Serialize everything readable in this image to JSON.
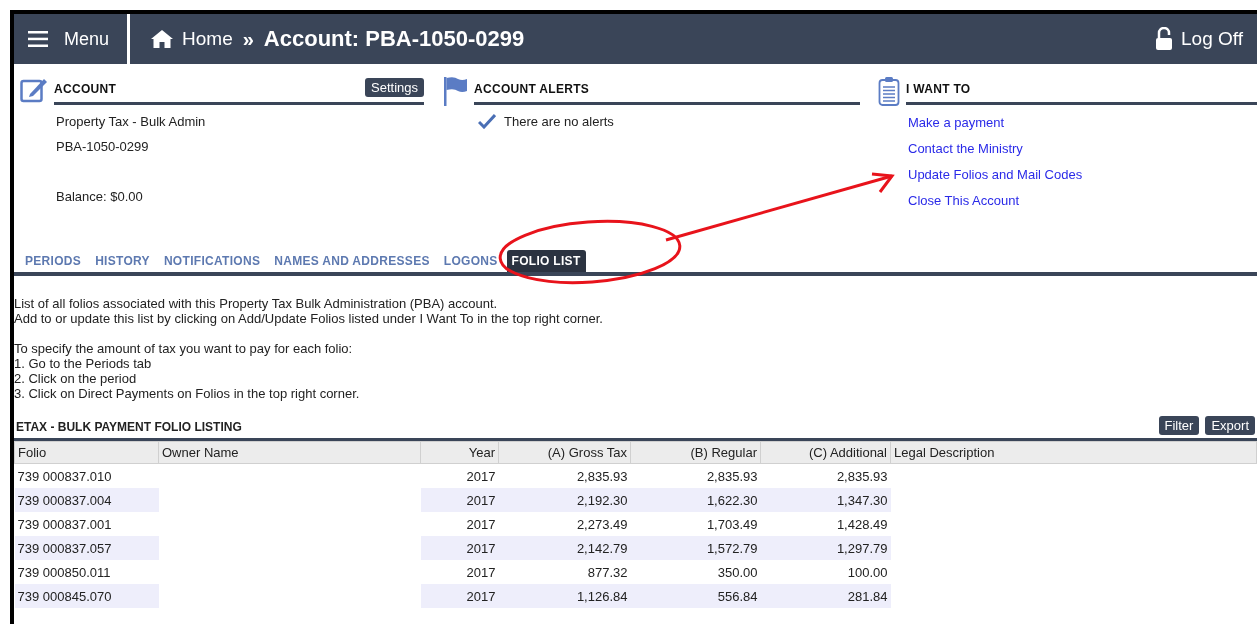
{
  "header": {
    "menu_label": "Menu",
    "home_label": "Home",
    "separator": "»",
    "title": "Account: PBA-1050-0299",
    "logoff_label": "Log Off"
  },
  "account": {
    "heading": "ACCOUNT",
    "settings_label": "Settings",
    "lines": [
      "Property Tax - Bulk Admin",
      "PBA-1050-0299"
    ],
    "balance": "Balance: $0.00"
  },
  "alerts": {
    "heading": "ACCOUNT ALERTS",
    "message": "There are no alerts"
  },
  "i_want_to": {
    "heading": "I WANT TO",
    "links": [
      "Make a payment",
      "Contact the Ministry",
      "Update Folios and Mail Codes",
      "Close This Account"
    ]
  },
  "tabs": [
    {
      "label": "PERIODS",
      "selected": false
    },
    {
      "label": "HISTORY",
      "selected": false
    },
    {
      "label": "NOTIFICATIONS",
      "selected": false
    },
    {
      "label": "NAMES AND ADDRESSES",
      "selected": false
    },
    {
      "label": "LOGONS",
      "selected": false
    },
    {
      "label": "FOLIO LIST",
      "selected": true
    }
  ],
  "intro": [
    "List of all folios associated with this Property Tax Bulk Administration (PBA) account.",
    "Add to or update this list by clicking on Add/Update Folios listed under I Want To in the top right corner."
  ],
  "instructions": [
    "To specify the amount of tax you want to pay for each folio:",
    "1. Go to the Periods tab",
    "2. Click on the period",
    "3. Click on Direct Payments on Folios in the top right corner."
  ],
  "table": {
    "title": "ETAX - BULK PAYMENT FOLIO LISTING",
    "buttons": [
      "Filter",
      "Export"
    ],
    "columns": [
      "Folio",
      "Owner Name",
      "Year",
      "(A) Gross Tax",
      "(B) Regular",
      "(C) Additional",
      "Legal Description"
    ],
    "rows": [
      [
        "739 000837.010",
        "",
        "2017",
        "2,835.93",
        "2,835.93",
        "2,835.93",
        ""
      ],
      [
        "739 000837.004",
        "",
        "2017",
        "2,192.30",
        "1,622.30",
        "1,347.30",
        ""
      ],
      [
        "739 000837.001",
        "",
        "2017",
        "2,273.49",
        "1,703.49",
        "1,428.49",
        ""
      ],
      [
        "739 000837.057",
        "",
        "2017",
        "2,142.79",
        "1,572.79",
        "1,297.79",
        ""
      ],
      [
        "739 000850.011",
        "",
        "2017",
        "877.32",
        "350.00",
        "100.00",
        ""
      ],
      [
        "739 000845.070",
        "",
        "2017",
        "1,126.84",
        "556.84",
        "281.84",
        ""
      ]
    ]
  }
}
